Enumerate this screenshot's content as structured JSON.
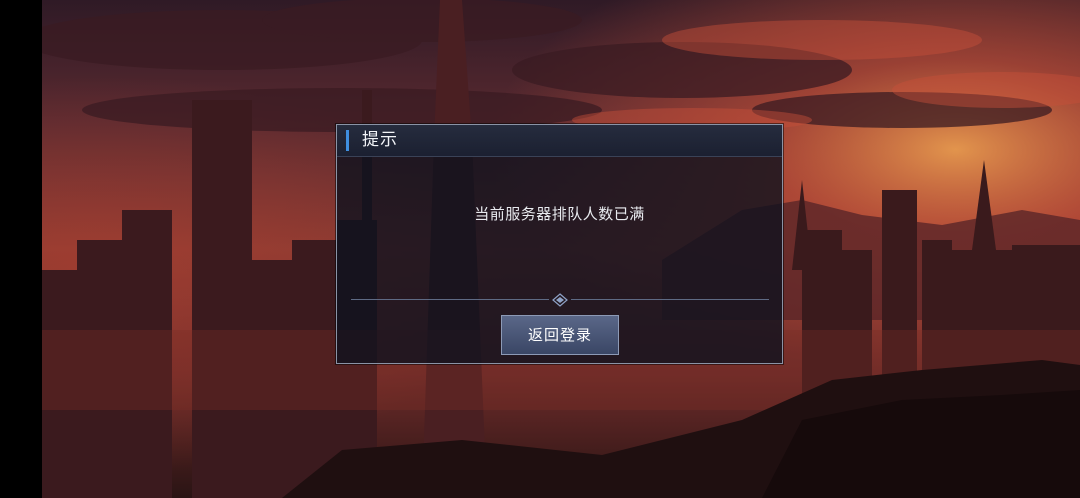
{
  "dialog": {
    "title": "提示",
    "message": "当前服务器排队人数已满",
    "button_label": "返回登录",
    "accent_color": "#3f8fe0"
  },
  "icons": {
    "divider_ornament": "diamond-ornament-icon"
  },
  "colors": {
    "sky_top": "#3a1e2a",
    "sky_glow": "#d2553a",
    "dialog_bg": "#0e121e",
    "button_bg": "#4a5676"
  }
}
